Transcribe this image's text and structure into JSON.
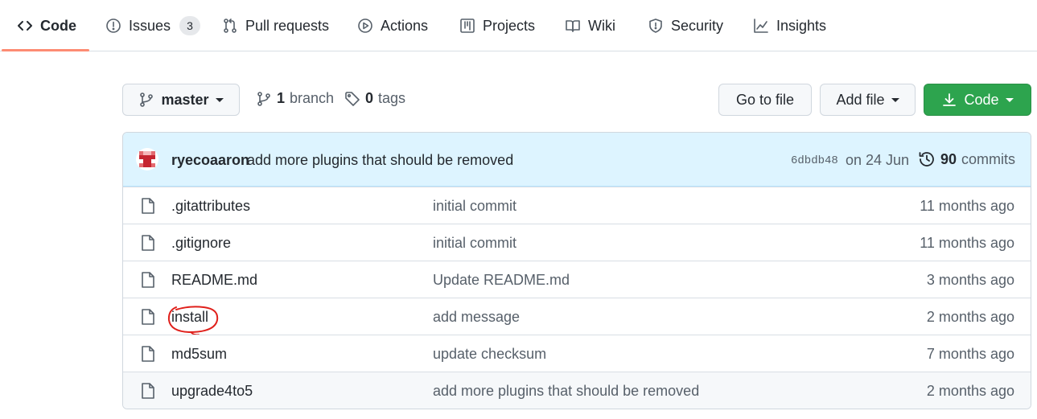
{
  "tabs": [
    {
      "label": "Code",
      "icon": "code-icon",
      "selected": true
    },
    {
      "label": "Issues",
      "icon": "issue-opened-icon",
      "count": "3"
    },
    {
      "label": "Pull requests",
      "icon": "git-pull-request-icon"
    },
    {
      "label": "Actions",
      "icon": "play-icon"
    },
    {
      "label": "Projects",
      "icon": "table-icon"
    },
    {
      "label": "Wiki",
      "icon": "book-icon"
    },
    {
      "label": "Security",
      "icon": "shield-icon"
    },
    {
      "label": "Insights",
      "icon": "graph-icon"
    }
  ],
  "toolbar": {
    "branch_selector": "master",
    "branch_count": "1",
    "branch_label": "branch",
    "tag_count": "0",
    "tag_label": "tags",
    "go_to_file": "Go to file",
    "add_file": "Add file",
    "code_button": "Code"
  },
  "latest_commit": {
    "author": "ryecoaaron",
    "message": "add more plugins that should be removed",
    "sha": "6dbdb48",
    "date": "on 24 Jun",
    "commit_count": "90",
    "commit_label": "commits"
  },
  "files": [
    {
      "name": ".gitattributes",
      "message": "initial commit",
      "age": "11 months ago"
    },
    {
      "name": ".gitignore",
      "message": "initial commit",
      "age": "11 months ago"
    },
    {
      "name": "README.md",
      "message": "Update README.md",
      "age": "3 months ago"
    },
    {
      "name": "install",
      "message": "add message",
      "age": "2 months ago",
      "annotated": true
    },
    {
      "name": "md5sum",
      "message": "update checksum",
      "age": "7 months ago"
    },
    {
      "name": "upgrade4to5",
      "message": "add more plugins that should be removed",
      "age": "2 months ago"
    }
  ],
  "colors": {
    "accent_underline": "#fd8c73",
    "primary_button": "#2da44e",
    "commit_header_bg": "#ddf4ff",
    "annotation_circle": "#e0201b"
  }
}
